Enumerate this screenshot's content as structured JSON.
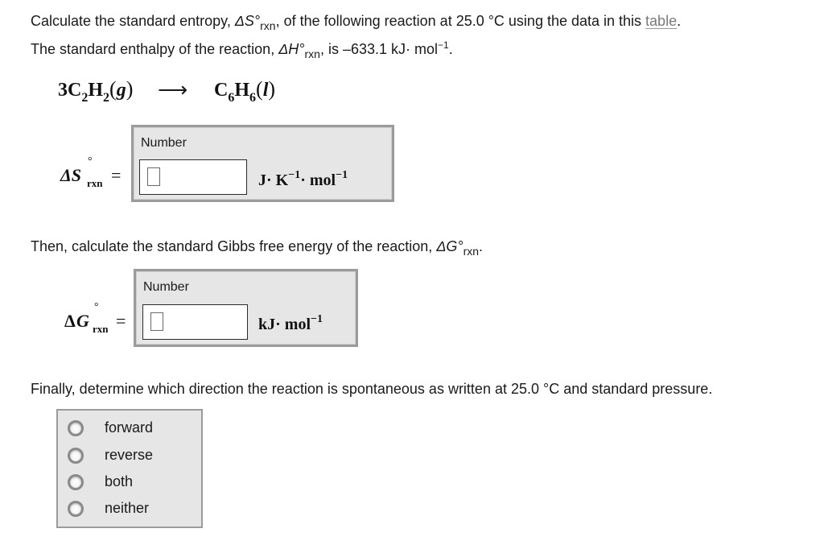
{
  "question": {
    "line1": {
      "prefix": "Calculate the standard entropy, ",
      "symbol": "ΔS°",
      "symbol_sub": "rxn",
      "middle": ", of the following reaction at 25.0 °C using the data in this ",
      "link_text": "table",
      "suffix": "."
    },
    "line2": {
      "prefix": "The standard enthalpy of the reaction, ",
      "symbol": "ΔH°",
      "symbol_sub": "rxn",
      "middle": ", is –633.1 kJ· mol",
      "exp": "−1",
      "suffix": "."
    }
  },
  "reaction": {
    "coef": "3",
    "reactant_a": "C",
    "reactant_a_sub": "2",
    "reactant_b": "H",
    "reactant_b_sub": "2",
    "reactant_phase": "g",
    "arrow": "⟶",
    "product_a": "C",
    "product_a_sub": "6",
    "product_b": "H",
    "product_b_sub": "6",
    "product_phase": "l"
  },
  "entropy_answer": {
    "lhs_symbol": "ΔS",
    "lhs_degree": "°",
    "lhs_sub": "rxn",
    "equals": "=",
    "label": "Number",
    "value": "",
    "unit_j": "J· K",
    "unit_exp1": "−1",
    "unit_mol": "· mol",
    "unit_exp2": "−1"
  },
  "gibbs_prompt": {
    "prefix": "Then, calculate the standard Gibbs free energy of the reaction, ",
    "symbol": "ΔG°",
    "symbol_sub": "rxn",
    "suffix": "."
  },
  "gibbs_answer": {
    "lhs_delta": "Δ",
    "lhs_symbol": "G",
    "lhs_degree": "°",
    "lhs_sub": "rxn",
    "equals": "=",
    "label": "Number",
    "value": "",
    "unit": "kJ· mol",
    "unit_exp": "−1"
  },
  "direction_prompt": "Finally, determine which direction the reaction is spontaneous as written at 25.0 °C and standard pressure.",
  "direction_options": [
    {
      "label": "forward",
      "selected": false
    },
    {
      "label": "reverse",
      "selected": false
    },
    {
      "label": "both",
      "selected": false
    },
    {
      "label": "neither",
      "selected": false
    }
  ]
}
